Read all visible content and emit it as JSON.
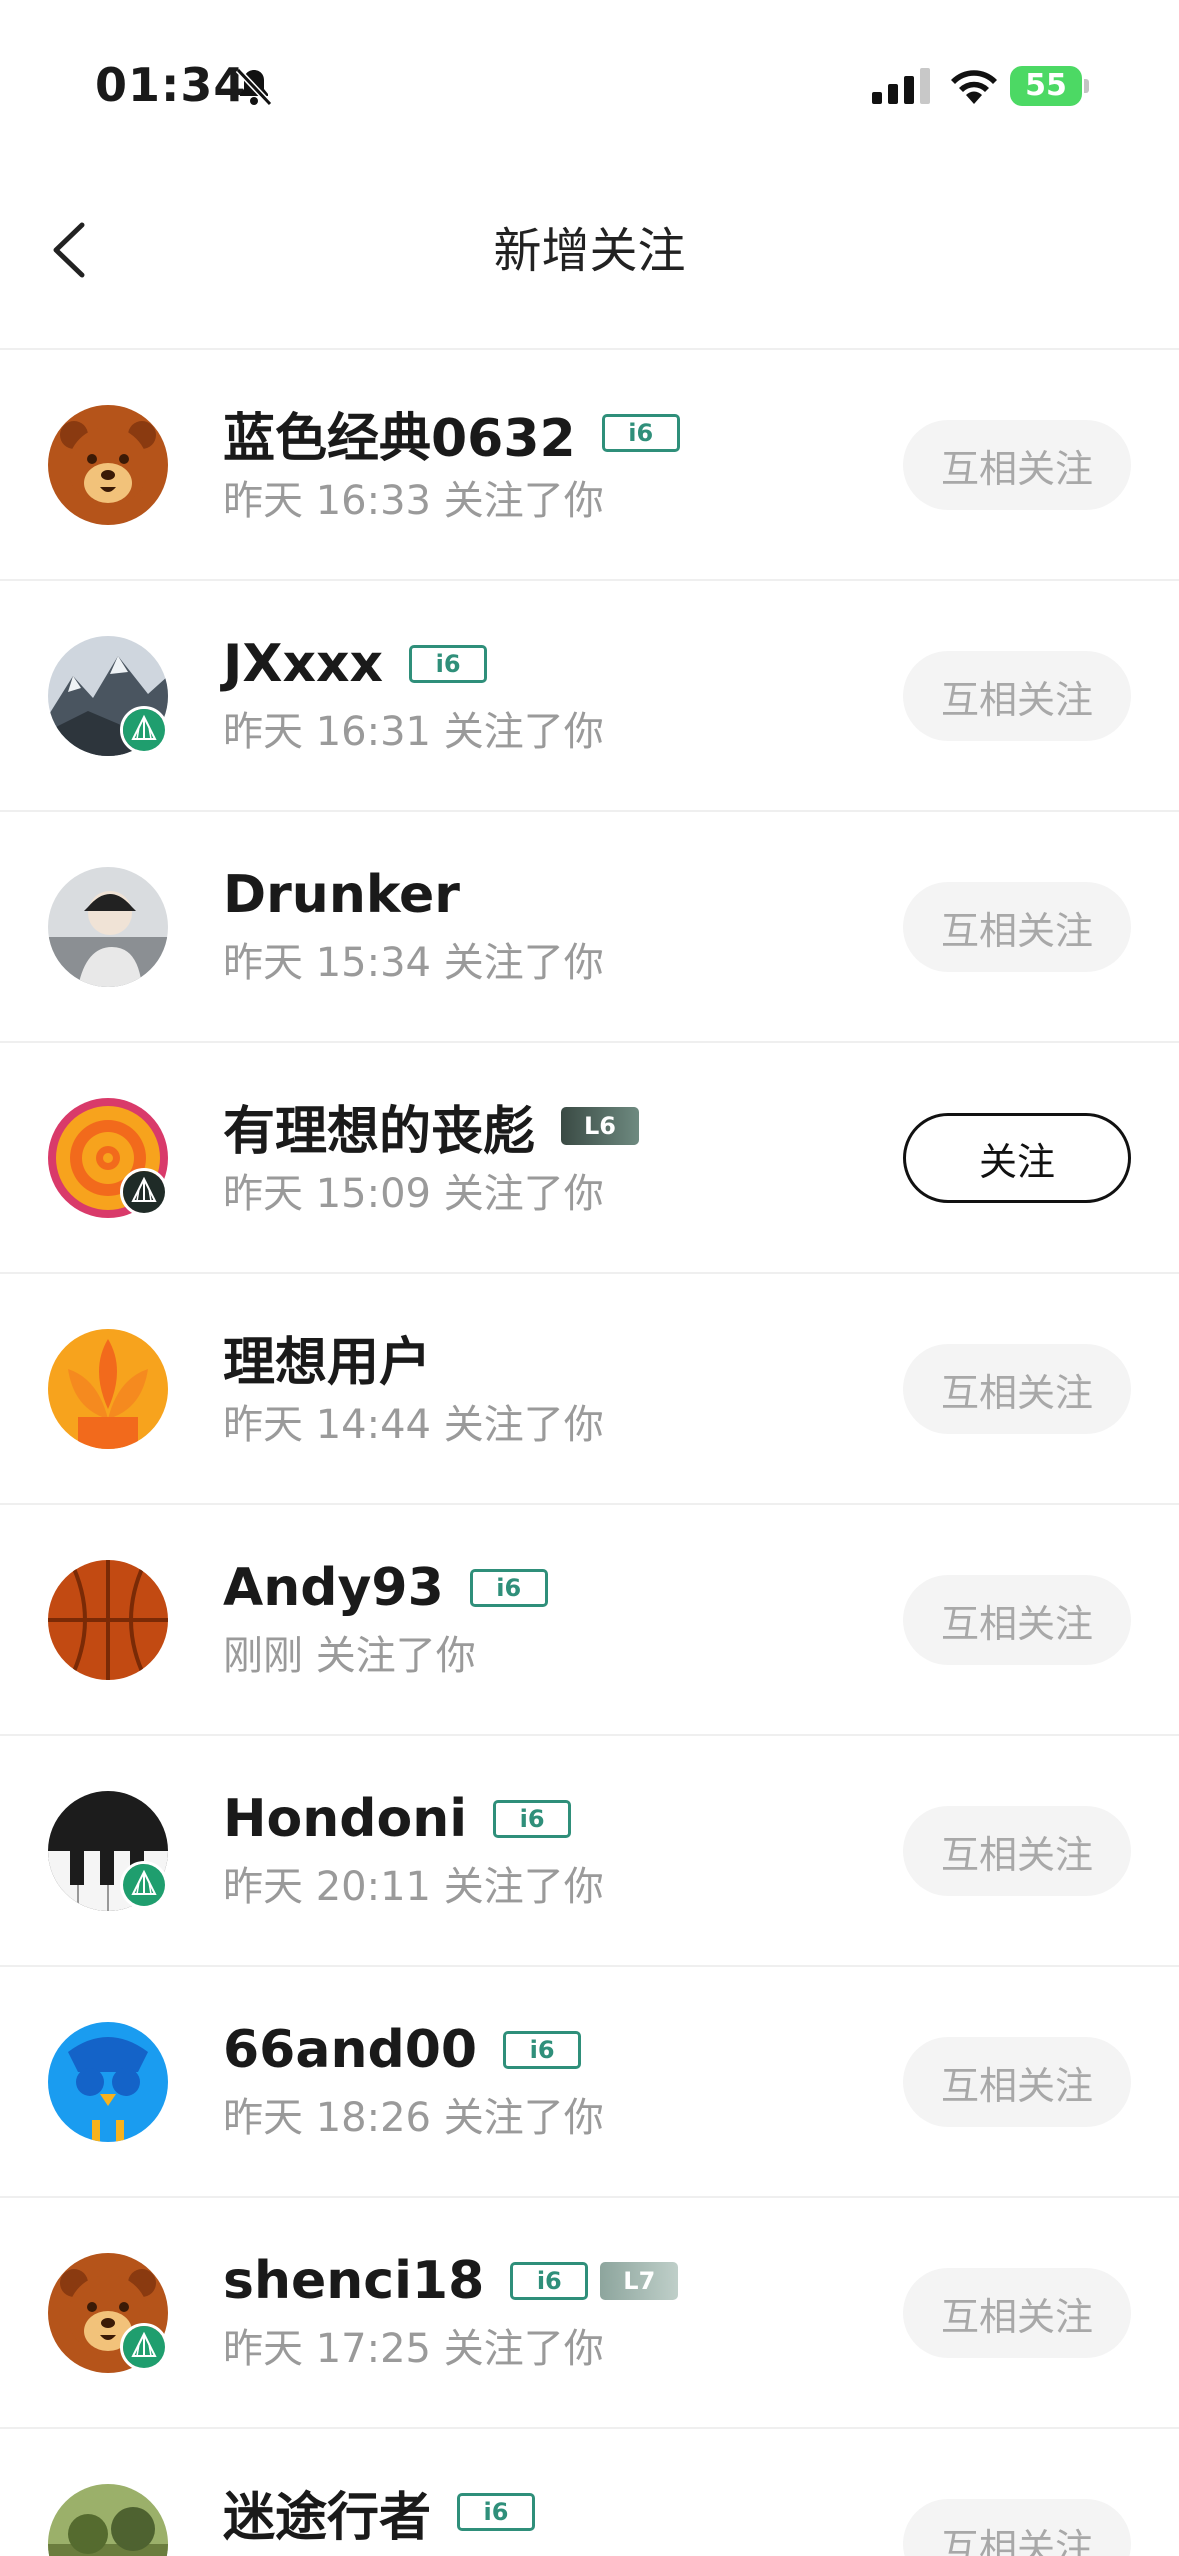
{
  "status_bar": {
    "time": "01:34",
    "battery": "55",
    "icons": [
      "bell-slash-icon",
      "signal-icon",
      "wifi-icon",
      "battery-charging-icon"
    ]
  },
  "nav": {
    "title": "新增关注",
    "back_icon": "chevron-left-icon"
  },
  "users": [
    {
      "name": "蓝色经典0632",
      "tags": [
        "i6"
      ],
      "subtitle": "昨天 16:33 关注了你",
      "button": "互相关注",
      "avatar": "bear-avatar",
      "verified": false
    },
    {
      "name": "JXxxx",
      "tags": [
        "i6"
      ],
      "subtitle": "昨天 16:31 关注了你",
      "button": "互相关注",
      "avatar": "mountain-photo-avatar",
      "verified": true
    },
    {
      "name": "Drunker",
      "tags": [],
      "subtitle": "昨天 15:34 关注了你",
      "button": "互相关注",
      "avatar": "person-photo-avatar",
      "verified": false
    },
    {
      "name": "有理想的丧彪",
      "tags": [
        "L6"
      ],
      "subtitle": "昨天 15:09 关注了你",
      "button": "关注",
      "avatar": "target-avatar",
      "verified": true
    },
    {
      "name": "理想用户",
      "tags": [],
      "subtitle": "昨天 14:44 关注了你",
      "button": "互相关注",
      "avatar": "leaf-avatar",
      "verified": false
    },
    {
      "name": "Andy93",
      "tags": [
        "i6"
      ],
      "subtitle": "刚刚 关注了你",
      "button": "互相关注",
      "avatar": "basketball-avatar",
      "verified": false
    },
    {
      "name": "Hondoni",
      "tags": [
        "i6"
      ],
      "subtitle": "昨天 20:11 关注了你",
      "button": "互相关注",
      "avatar": "piano-avatar",
      "verified": true
    },
    {
      "name": "66and00",
      "tags": [
        "i6"
      ],
      "subtitle": "昨天 18:26 关注了你",
      "button": "互相关注",
      "avatar": "bird-avatar",
      "verified": false
    },
    {
      "name": "shenci18",
      "tags": [
        "i6",
        "L7"
      ],
      "subtitle": "昨天 17:25 关注了你",
      "button": "互相关注",
      "avatar": "bear-avatar",
      "verified": true
    },
    {
      "name": "迷途行者",
      "tags": [
        "i6"
      ],
      "subtitle": "",
      "button": "互相关注",
      "avatar": "landscape-photo-avatar",
      "verified": false
    }
  ],
  "colors": {
    "tag_i6": "#2f8f7a",
    "muted_text": "#9a9a9a",
    "mutual_button_bg": "#f4f4f4",
    "battery": "#4cd964"
  }
}
